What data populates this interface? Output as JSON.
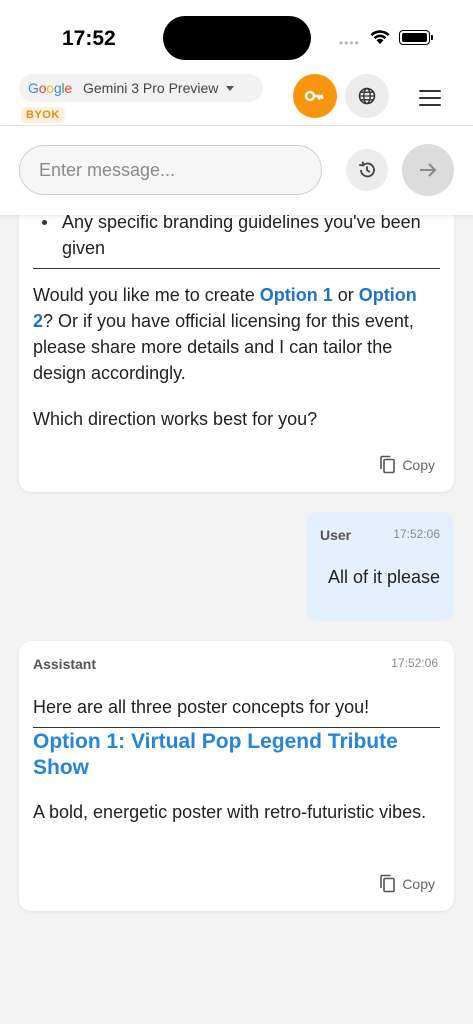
{
  "status": {
    "time": "17:52"
  },
  "header": {
    "google_logo": "Google",
    "model_name": "Gemini 3 Pro Preview",
    "byok_badge": "BYOK"
  },
  "composer": {
    "placeholder": "Enter message..."
  },
  "messages": [
    {
      "role": "assistant",
      "bullet": "Any specific branding guidelines you've been given",
      "para1_a": "Would you like me to create ",
      "para1_link1": "Option 1",
      "para1_b": " or ",
      "para1_link2": "Option 2",
      "para1_c": "? Or if you have official licensing for this event, please share more details and I can tailor the design accordingly.",
      "para2": "Which direction works best for you?",
      "copy_label": "Copy"
    },
    {
      "role_label": "User",
      "time": "17:52:06",
      "text": "All of it please"
    },
    {
      "role_label": "Assistant",
      "time": "17:52:06",
      "intro": "Here are all three poster concepts for you!",
      "heading": "Option 1: Virtual Pop Legend Tribute Show",
      "desc": "A bold, energetic poster with retro-futuristic vibes.",
      "copy_label": "Copy"
    }
  ],
  "colors": {
    "accent_orange": "#f7960c",
    "link_blue": "#1f74c7",
    "heading_blue": "#2585d9",
    "user_bubble": "#e4f0fd"
  }
}
